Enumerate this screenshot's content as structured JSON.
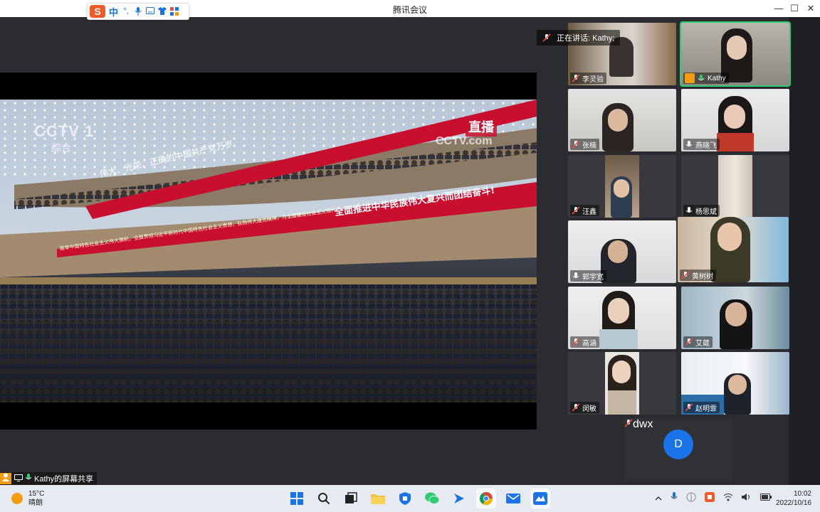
{
  "window": {
    "title": "腾讯会议",
    "minimize": "—",
    "maximize": "☐",
    "close": "✕"
  },
  "ime": {
    "logo": "S",
    "mode": "中"
  },
  "share": {
    "sharer_label": "Kathy的屏幕共享",
    "broadcast": {
      "channel_logo": "CCTV 1",
      "channel_name": "综合",
      "live_badge": "直播",
      "watermark": "CCTV.com",
      "banner_top": "伟大、光荣、正确的中国共产党万岁",
      "banner_main": "全面推进中华民族伟大复兴而团结奋斗!",
      "banner_lower": "高举中国特色社会主义伟大旗帜，全面贯彻习近平新时代中国特色社会主义思想，弘扬伟大建党精神，为全面建设社会主义现代化国家、全面推进中华民族伟大复兴而团结奋斗"
    }
  },
  "speaking": {
    "label": "正在讲话: Kathy;"
  },
  "participants": [
    {
      "name": "李灵验",
      "muted": true
    },
    {
      "name": "Kathy",
      "muted": false
    },
    {
      "name": "张楠",
      "muted": true
    },
    {
      "name": "燕晓飞",
      "muted": false
    },
    {
      "name": "汪鑫",
      "muted": true
    },
    {
      "name": "杨思斌",
      "muted": false
    },
    {
      "name": "郭宇宽",
      "muted": false
    },
    {
      "name": "黄树树",
      "muted": true
    },
    {
      "name": "高涵",
      "muted": true
    },
    {
      "name": "艾葳",
      "muted": true
    },
    {
      "name": "闵敏",
      "muted": true
    },
    {
      "name": "赵明霏",
      "muted": true
    },
    {
      "name": "dwx",
      "muted": true,
      "avatar": "D"
    }
  ],
  "taskbar": {
    "weather_temp": "15°C",
    "weather_desc": "晴朗",
    "time": "10:02",
    "date": "2022/10/16"
  },
  "colors": {
    "accent": "#1a73e8",
    "active_speaker": "#2ecc71",
    "mute": "#e74c3c"
  }
}
